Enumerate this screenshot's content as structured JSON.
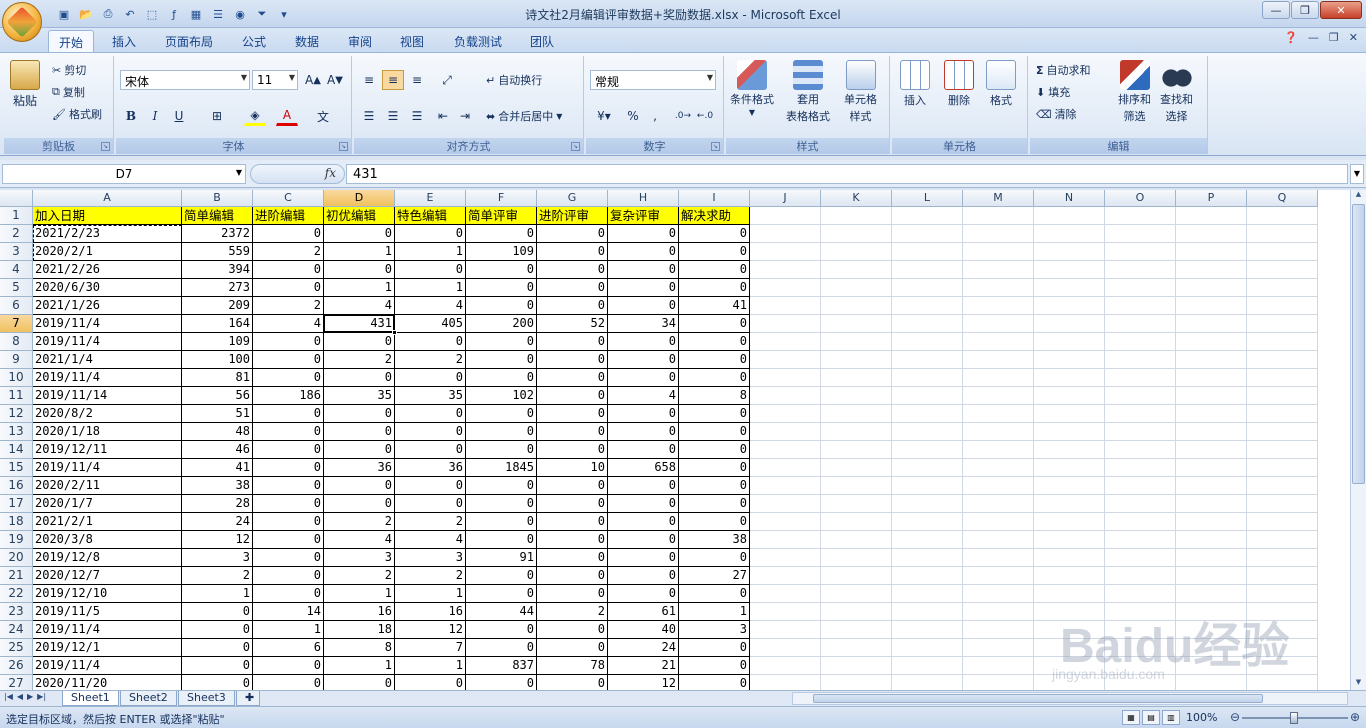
{
  "window": {
    "title": "诗文社2月编辑评审数据+奖励数据.xlsx - Microsoft Excel"
  },
  "ribbon_tabs": [
    "开始",
    "插入",
    "页面布局",
    "公式",
    "数据",
    "审阅",
    "视图",
    "负载测试",
    "团队"
  ],
  "ribbon": {
    "clipboard": {
      "paste": "粘贴",
      "cut": "剪切",
      "copy": "复制",
      "format_painter": "格式刷",
      "label": "剪贴板"
    },
    "font": {
      "name": "宋体",
      "size": "11",
      "label": "字体",
      "bold": "B",
      "italic": "I",
      "underline": "U"
    },
    "alignment": {
      "wrap": "自动换行",
      "merge": "合并后居中",
      "label": "对齐方式"
    },
    "number": {
      "format": "常规",
      "percent": "%",
      "comma": ",",
      "label": "数字"
    },
    "styles": {
      "conditional": "条件格式",
      "table_format_1": "套用",
      "table_format_2": "表格格式",
      "cell_styles_1": "单元格",
      "cell_styles_2": "样式",
      "label": "样式"
    },
    "cells": {
      "insert": "插入",
      "delete": "删除",
      "format": "格式",
      "label": "单元格"
    },
    "editing": {
      "autosum": "自动求和",
      "fill": "填充",
      "clear": "清除",
      "sort_1": "排序和",
      "sort_2": "筛选",
      "find_1": "查找和",
      "find_2": "选择",
      "label": "编辑"
    }
  },
  "formula_bar": {
    "name_box": "D7",
    "fx": "fx",
    "value": "431"
  },
  "columns": [
    "A",
    "B",
    "C",
    "D",
    "E",
    "F",
    "G",
    "H",
    "I",
    "J",
    "K",
    "L",
    "M",
    "N",
    "O",
    "P",
    "Q"
  ],
  "header_row": [
    "加入日期",
    "简单编辑",
    "进阶编辑",
    "初优编辑",
    "特色编辑",
    "简单评审",
    "进阶评审",
    "复杂评审",
    "解决求助"
  ],
  "rows": [
    [
      "2021/2/23",
      "2372",
      "0",
      "0",
      "0",
      "0",
      "0",
      "0",
      "0"
    ],
    [
      "2020/2/1",
      "559",
      "2",
      "1",
      "1",
      "109",
      "0",
      "0",
      "0"
    ],
    [
      "2021/2/26",
      "394",
      "0",
      "0",
      "0",
      "0",
      "0",
      "0",
      "0"
    ],
    [
      "2020/6/30",
      "273",
      "0",
      "1",
      "1",
      "0",
      "0",
      "0",
      "0"
    ],
    [
      "2021/1/26",
      "209",
      "2",
      "4",
      "4",
      "0",
      "0",
      "0",
      "41"
    ],
    [
      "2019/11/4",
      "164",
      "4",
      "431",
      "405",
      "200",
      "52",
      "34",
      "0"
    ],
    [
      "2019/11/4",
      "109",
      "0",
      "0",
      "0",
      "0",
      "0",
      "0",
      "0"
    ],
    [
      "2021/1/4",
      "100",
      "0",
      "2",
      "2",
      "0",
      "0",
      "0",
      "0"
    ],
    [
      "2019/11/4",
      "81",
      "0",
      "0",
      "0",
      "0",
      "0",
      "0",
      "0"
    ],
    [
      "2019/11/14",
      "56",
      "186",
      "35",
      "35",
      "102",
      "0",
      "4",
      "8"
    ],
    [
      "2020/8/2",
      "51",
      "0",
      "0",
      "0",
      "0",
      "0",
      "0",
      "0"
    ],
    [
      "2020/1/18",
      "48",
      "0",
      "0",
      "0",
      "0",
      "0",
      "0",
      "0"
    ],
    [
      "2019/12/11",
      "46",
      "0",
      "0",
      "0",
      "0",
      "0",
      "0",
      "0"
    ],
    [
      "2019/11/4",
      "41",
      "0",
      "36",
      "36",
      "1845",
      "10",
      "658",
      "0"
    ],
    [
      "2020/2/11",
      "38",
      "0",
      "0",
      "0",
      "0",
      "0",
      "0",
      "0"
    ],
    [
      "2020/1/7",
      "28",
      "0",
      "0",
      "0",
      "0",
      "0",
      "0",
      "0"
    ],
    [
      "2021/2/1",
      "24",
      "0",
      "2",
      "2",
      "0",
      "0",
      "0",
      "0"
    ],
    [
      "2020/3/8",
      "12",
      "0",
      "4",
      "4",
      "0",
      "0",
      "0",
      "38"
    ],
    [
      "2019/12/8",
      "3",
      "0",
      "3",
      "3",
      "91",
      "0",
      "0",
      "0"
    ],
    [
      "2020/12/7",
      "2",
      "0",
      "2",
      "2",
      "0",
      "0",
      "0",
      "27"
    ],
    [
      "2019/12/10",
      "1",
      "0",
      "1",
      "1",
      "0",
      "0",
      "0",
      "0"
    ],
    [
      "2019/11/5",
      "0",
      "14",
      "16",
      "16",
      "44",
      "2",
      "61",
      "1"
    ],
    [
      "2019/11/4",
      "0",
      "1",
      "18",
      "12",
      "0",
      "0",
      "40",
      "3"
    ],
    [
      "2019/12/1",
      "0",
      "6",
      "8",
      "7",
      "0",
      "0",
      "24",
      "0"
    ],
    [
      "2019/11/4",
      "0",
      "0",
      "1",
      "1",
      "837",
      "78",
      "21",
      "0"
    ],
    [
      "2020/11/20",
      "0",
      "0",
      "0",
      "0",
      "0",
      "0",
      "12",
      "0"
    ]
  ],
  "sheets": [
    "Sheet1",
    "Sheet2",
    "Sheet3"
  ],
  "status": {
    "message": "选定目标区域，然后按 ENTER 或选择\"粘贴\"",
    "zoom": "100%"
  },
  "watermark": {
    "main": "Baidu经验",
    "sub": "jingyan.baidu.com"
  },
  "colors": {
    "header_fill": "#ffff00",
    "selection": "#f1c15f"
  }
}
